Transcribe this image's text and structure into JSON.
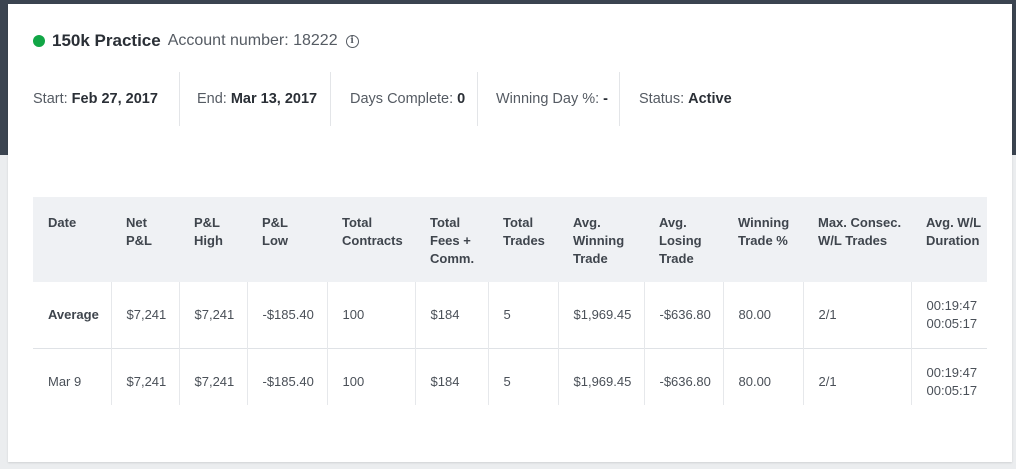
{
  "account": {
    "name": "150k Practice",
    "number_label": "Account number: 18222",
    "status_color": "#11a646"
  },
  "stats": {
    "start_label": "Start:",
    "start_value": "Feb 27, 2017",
    "end_label": "End:",
    "end_value": "Mar 13, 2017",
    "days_label": "Days Complete:",
    "days_value": "0",
    "winning_day_label": "Winning Day %:",
    "winning_day_value": "-",
    "status_label": "Status:",
    "status_value": "Active"
  },
  "table": {
    "headers": [
      {
        "line1": "Date",
        "line2": "",
        "line3": ""
      },
      {
        "line1": "Net",
        "line2": "P&L",
        "line3": ""
      },
      {
        "line1": "P&L",
        "line2": "High",
        "line3": ""
      },
      {
        "line1": "P&L",
        "line2": "Low",
        "line3": ""
      },
      {
        "line1": "Total",
        "line2": "Contracts",
        "line3": ""
      },
      {
        "line1": "Total",
        "line2": "Fees +",
        "line3": "Comm."
      },
      {
        "line1": "Total",
        "line2": "Trades",
        "line3": ""
      },
      {
        "line1": "Avg.",
        "line2": "Winning",
        "line3": "Trade"
      },
      {
        "line1": "Avg.",
        "line2": "Losing",
        "line3": "Trade"
      },
      {
        "line1": "Winning",
        "line2": "Trade %",
        "line3": ""
      },
      {
        "line1": "Max. Consec.",
        "line2": "W/L Trades",
        "line3": ""
      },
      {
        "line1": "Avg. W/L",
        "line2": "Duration",
        "line3": ""
      }
    ],
    "rows": [
      {
        "date": "Average",
        "net_pnl": "$7,241",
        "pnl_high": "$7,241",
        "pnl_low": "-$185.40",
        "total_contracts": "100",
        "total_fees": "$184",
        "total_trades": "5",
        "avg_winning": "$1,969.45",
        "avg_losing": "-$636.80",
        "winning_pct": "80.00",
        "max_consec": "2/1",
        "duration_win": "00:19:47",
        "duration_loss": "00:05:17"
      },
      {
        "date": "Mar 9",
        "net_pnl": "$7,241",
        "pnl_high": "$7,241",
        "pnl_low": "-$185.40",
        "total_contracts": "100",
        "total_fees": "$184",
        "total_trades": "5",
        "avg_winning": "$1,969.45",
        "avg_losing": "-$636.80",
        "winning_pct": "80.00",
        "max_consec": "2/1",
        "duration_win": "00:19:47",
        "duration_loss": "00:05:17"
      }
    ]
  }
}
